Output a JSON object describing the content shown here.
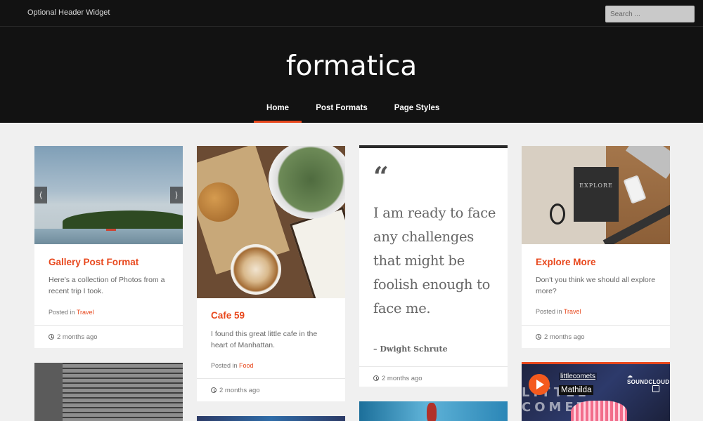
{
  "topbar": {
    "header_widget": "Optional Header Widget",
    "search_placeholder": "Search ..."
  },
  "header": {
    "logo_prefix": "formati",
    "logo_suffix": "ca"
  },
  "nav": {
    "items": [
      {
        "label": "Home",
        "active": true
      },
      {
        "label": "Post Formats",
        "active": false
      },
      {
        "label": "Page Styles",
        "active": false
      }
    ]
  },
  "posts": {
    "gallery": {
      "title": "Gallery Post Format",
      "excerpt": "Here's a collection of Photos from a recent trip I took.",
      "posted_in": "Posted in",
      "category": "Travel",
      "date": "2 months ago",
      "prev_arrow": "⟨",
      "next_arrow": "⟩"
    },
    "cafe": {
      "title": "Cafe 59",
      "excerpt": "I found this great little cafe in the heart of Manhattan.",
      "posted_in": "Posted in",
      "category": "Food",
      "date": "2 months ago"
    },
    "quote": {
      "text": "I am ready to face any challenges that might be foolish enough to face me.",
      "author": "– Dwight Schrute",
      "date": "2 months ago",
      "icon": "quote-icon"
    },
    "explore": {
      "title": "Explore More",
      "excerpt": "Don't you think we should all explore more?",
      "posted_in": "Posted in",
      "category": "Travel",
      "date": "2 months ago",
      "image_text": "EXPLORE"
    },
    "soundcloud": {
      "user": "littlecomets",
      "track": "Mathilda",
      "logo": "☁ SOUNDCLOUD",
      "image_text": "LITTLE COMETS"
    }
  },
  "colors": {
    "accent": "#e8481d",
    "header_bg": "#121212",
    "page_bg": "#f0f0f0"
  }
}
